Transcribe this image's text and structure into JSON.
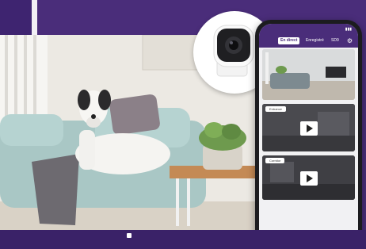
{
  "colors": {
    "brand_purple": "#4a2d7a",
    "dark_purple": "#3a2268",
    "screen_bg": "#f1f1f3"
  },
  "app": {
    "status_time": "",
    "tabs": [
      {
        "label": "En direct"
      },
      {
        "label": "Enregistré"
      },
      {
        "label": "SD9"
      }
    ],
    "settings_icon": "gear-icon",
    "feeds": [
      {
        "label": ""
      },
      {
        "label": "Entrance"
      },
      {
        "label": "Corridor"
      }
    ]
  }
}
